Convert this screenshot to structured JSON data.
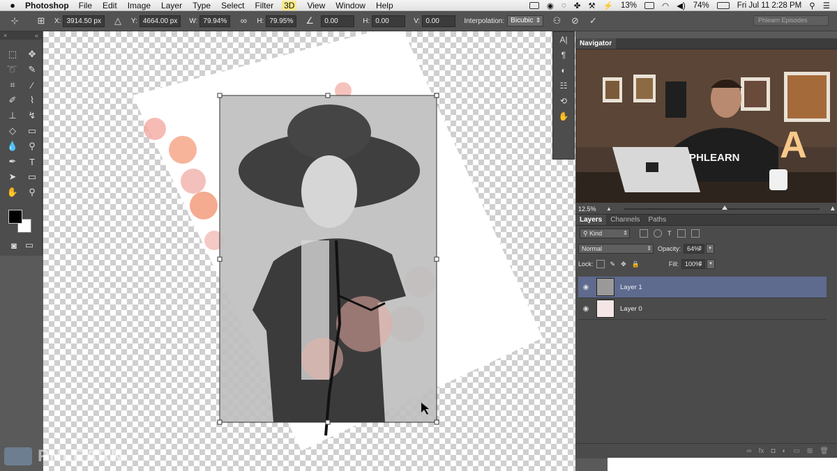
{
  "menubar": {
    "app_name": "Photoshop",
    "menus": [
      "File",
      "Edit",
      "Image",
      "Layer",
      "Type",
      "Select",
      "Filter",
      "3D",
      "View",
      "Window",
      "Help"
    ],
    "status": {
      "battery_cc": "13%",
      "battery": "74%",
      "clock": "Fri Jul 11  2:28 PM"
    }
  },
  "options_bar": {
    "x_label": "X:",
    "x_value": "3914.50 px",
    "y_label": "Y:",
    "y_value": "4664.00 px",
    "w_label": "W:",
    "w_value": "79.94%",
    "h_label": "H:",
    "h_value": "79.95%",
    "angle_value": "0.00",
    "hskew_label": "H:",
    "hskew_value": "0.00",
    "vskew_label": "V:",
    "vskew_value": "0.00",
    "interp_label": "Interpolation:",
    "interp_value": "Bicubic",
    "workspace": "Phlearn Episodes"
  },
  "navigator": {
    "tab": "Navigator",
    "zoom": "12.5%",
    "video_shirt_text": "PHLEARN",
    "video_sign_letter": "A"
  },
  "layers_panel": {
    "tabs": [
      "Layers",
      "Channels",
      "Paths"
    ],
    "kind_label": "Kind",
    "blend_mode": "Normal",
    "opacity_label": "Opacity:",
    "opacity_value": "64%",
    "lock_label": "Lock:",
    "fill_label": "Fill:",
    "fill_value": "100%",
    "layers": [
      {
        "name": "Layer 1",
        "selected": true
      },
      {
        "name": "Layer 0",
        "selected": false
      }
    ]
  },
  "watermark": "PHLEARN",
  "colors": {
    "selection": "#5e6a8e",
    "panel": "#4b4b4b",
    "menubar": "#ececec"
  }
}
